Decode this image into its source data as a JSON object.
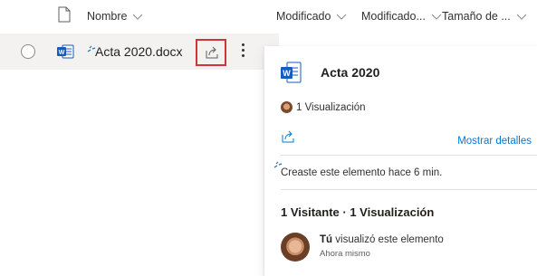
{
  "header": {
    "columns": [
      {
        "label": "Nombre"
      },
      {
        "label": "Modificado"
      },
      {
        "label": "Modificado..."
      },
      {
        "label": "Tamaño de ..."
      }
    ]
  },
  "file": {
    "name": "Acta 2020.docx",
    "icon": "word-doc-icon"
  },
  "card": {
    "title": "Acta 2020",
    "views": "1 Visualización",
    "show_details": "Mostrar detalles",
    "created": "Creaste este elemento hace 6 min.",
    "visitors_summary": "1 Visitante · 1 Visualización",
    "activity_user": "Tú",
    "activity_text": " visualizó este elemento",
    "activity_time": "Ahora mismo"
  },
  "colors": {
    "accent": "#0078d4",
    "word_blue": "#185abd",
    "highlight_border": "#d13438",
    "row_background": "#f3f2f1"
  }
}
